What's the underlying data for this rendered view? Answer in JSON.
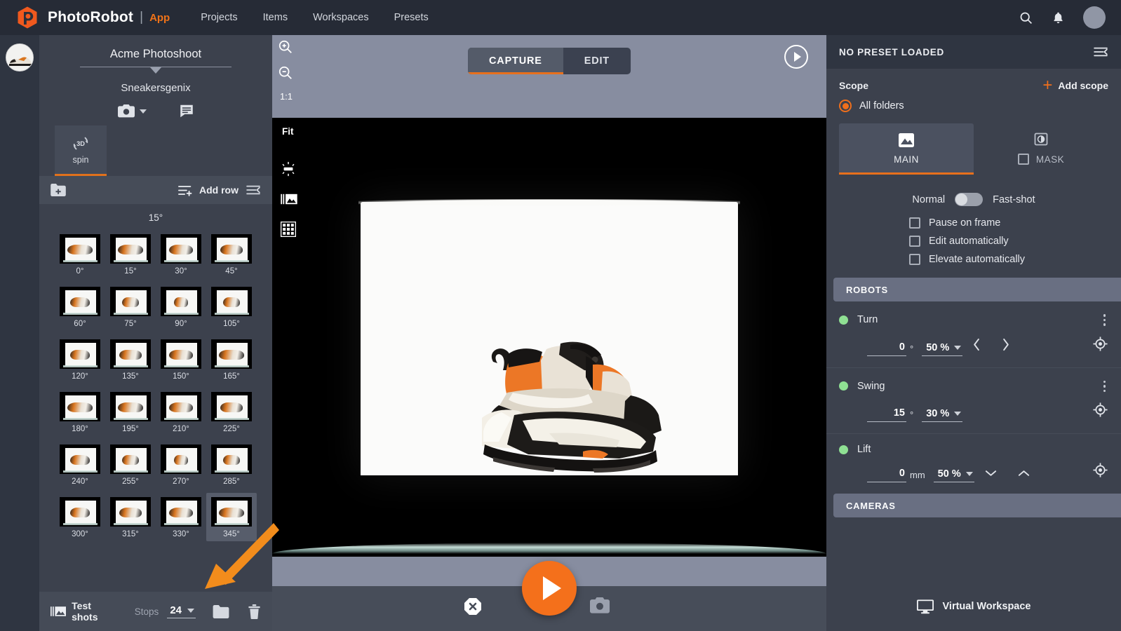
{
  "topnav": {
    "brand": "PhotoRobot",
    "separator": "|",
    "app_label": "App",
    "links": [
      {
        "label": "Projects"
      },
      {
        "label": "Items"
      },
      {
        "label": "Workspaces"
      },
      {
        "label": "Presets"
      }
    ],
    "icons": [
      "search-icon",
      "bell-icon",
      "avatar"
    ]
  },
  "left_panel": {
    "project_title": "Acme Photoshoot",
    "item_title": "Sneakersgenix",
    "spin_card": {
      "badge": "3D",
      "label": "spin"
    },
    "toolbar": {
      "add_row": "Add row"
    },
    "row_angle": "15°",
    "thumbnails": [
      {
        "label": "0°"
      },
      {
        "label": "15°"
      },
      {
        "label": "30°"
      },
      {
        "label": "45°"
      },
      {
        "label": "60°"
      },
      {
        "label": "75°"
      },
      {
        "label": "90°"
      },
      {
        "label": "105°"
      },
      {
        "label": "120°"
      },
      {
        "label": "135°"
      },
      {
        "label": "150°"
      },
      {
        "label": "165°"
      },
      {
        "label": "180°"
      },
      {
        "label": "195°"
      },
      {
        "label": "210°"
      },
      {
        "label": "225°"
      },
      {
        "label": "240°"
      },
      {
        "label": "255°"
      },
      {
        "label": "270°"
      },
      {
        "label": "285°"
      },
      {
        "label": "300°"
      },
      {
        "label": "315°"
      },
      {
        "label": "330°"
      },
      {
        "label": "345°"
      }
    ],
    "selected_thumbnail": "345°",
    "bottom": {
      "test_shots": "Test shots",
      "stops_label": "Stops",
      "stops_value": "24"
    }
  },
  "center": {
    "zoom_ratio": "1:1",
    "fit_label": "Fit",
    "tabs": [
      {
        "label": "CAPTURE",
        "active": true
      },
      {
        "label": "EDIT",
        "active": false
      }
    ]
  },
  "right_panel": {
    "header_title": "NO PRESET LOADED",
    "scope_label": "Scope",
    "add_scope": "Add scope",
    "scope_option": "All folders",
    "mode_tabs": [
      {
        "label": "MAIN",
        "active": true
      },
      {
        "label": "MASK",
        "active": false
      }
    ],
    "toggle": {
      "left": "Normal",
      "right": "Fast-shot"
    },
    "checkboxes": [
      {
        "label": "Pause on frame",
        "checked": false
      },
      {
        "label": "Edit automatically",
        "checked": false
      },
      {
        "label": "Elevate automatically",
        "checked": false
      }
    ],
    "robots_header": "ROBOTS",
    "robots": [
      {
        "name": "Turn",
        "value": "0",
        "unit": "°",
        "speed": "50 %",
        "status": "online"
      },
      {
        "name": "Swing",
        "value": "15",
        "unit": "°",
        "speed": "30 %",
        "status": "online"
      },
      {
        "name": "Lift",
        "value": "0",
        "unit": "mm",
        "speed": "50 %",
        "status": "online"
      }
    ],
    "cameras_header": "CAMERAS",
    "virtual_workspace": "Virtual Workspace"
  },
  "colors": {
    "accent": "#f07318",
    "nav_bg": "#262b36",
    "panel_bg": "#3c414d",
    "section_hdr": "#696f82",
    "viewport_chrome": "#878da0",
    "status_online": "#8fe093"
  }
}
